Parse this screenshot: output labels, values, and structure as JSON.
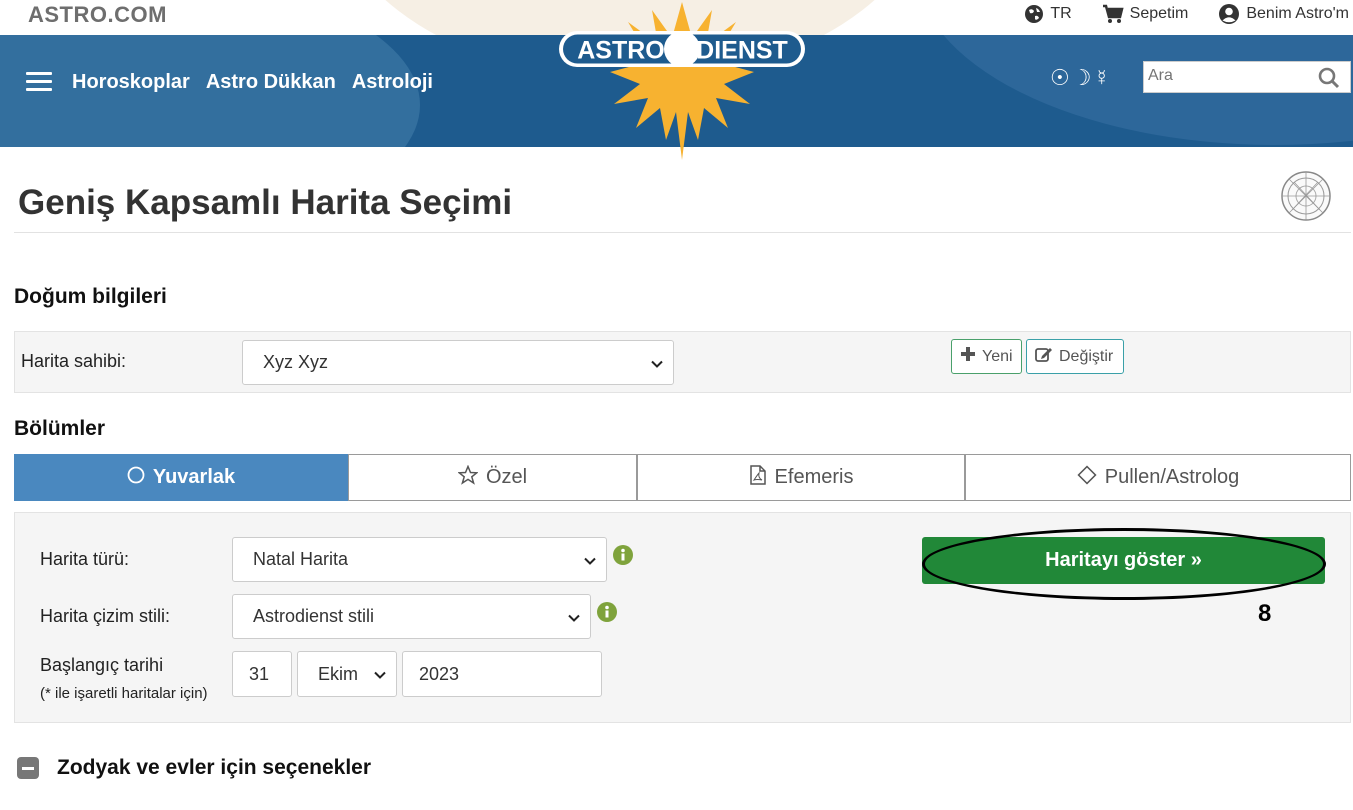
{
  "topbar": {
    "site_name": "ASTRO.COM",
    "language": "TR",
    "cart": "Sepetim",
    "account": "Benim Astro'm"
  },
  "header": {
    "nav": [
      "Horoskoplar",
      "Astro Dükkan",
      "Astroloji"
    ],
    "logo_left": "ASTRO",
    "logo_right": "DIENST",
    "symbols": "☉☽☿",
    "search_placeholder": "Ara"
  },
  "page": {
    "title": "Geniş Kapsamlı Harita Seçimi"
  },
  "birth": {
    "heading": "Doğum bilgileri",
    "owner_label": "Harita sahibi:",
    "owner_value": "Xyz Xyz",
    "new_button": "Yeni",
    "edit_button": "Değiştir"
  },
  "sections": {
    "heading": "Bölümler",
    "tabs": [
      {
        "label": "Yuvarlak",
        "icon": "circle-icon",
        "active": true
      },
      {
        "label": "Özel",
        "icon": "star-icon",
        "active": false
      },
      {
        "label": "Efemeris",
        "icon": "pdf-file-icon",
        "active": false
      },
      {
        "label": "Pullen/Astrolog",
        "icon": "diamond-icon",
        "active": false
      }
    ]
  },
  "chart_form": {
    "type_label": "Harita türü:",
    "type_value": "Natal Harita",
    "style_label": "Harita çizim stili:",
    "style_value": "Astrodienst stili",
    "start_label": "Başlangıç tarihi",
    "start_note": "(* ile işaretli haritalar için)",
    "day": "31",
    "month": "Ekim",
    "year": "2023",
    "show_button": "Haritayı göster »",
    "annotation_number": "8"
  },
  "options": {
    "heading": "Zodyak ve evler için seçenekler"
  },
  "colors": {
    "header_blue": "#1e5b8e",
    "tab_active": "#4a88bf",
    "primary_green": "#218838",
    "info_green": "#7fa33c"
  }
}
